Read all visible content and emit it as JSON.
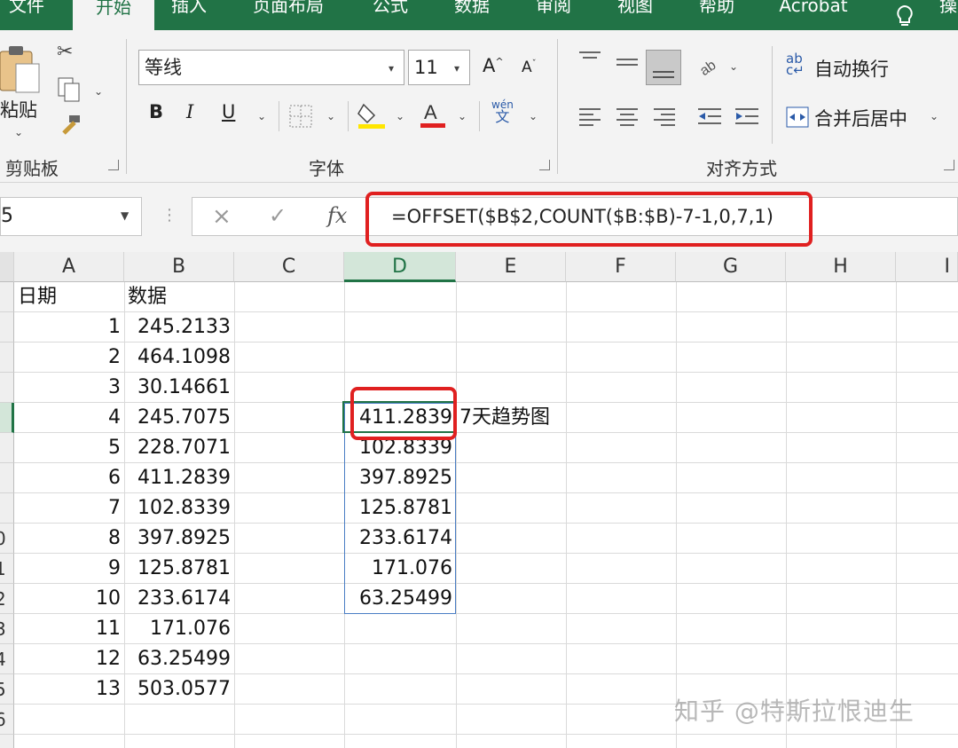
{
  "ribbon_tabs": [
    "文件",
    "开始",
    "插入",
    "页面布局",
    "公式",
    "数据",
    "审阅",
    "视图",
    "帮助",
    "Acrobat",
    "操"
  ],
  "active_tab": "开始",
  "clipboard": {
    "paste_label": "粘贴",
    "group_label": "剪贴板"
  },
  "font": {
    "family": "等线",
    "size": "11",
    "bold": "B",
    "italic": "I",
    "underline": "U",
    "phonetic": "wén\n文",
    "group_label": "字体"
  },
  "alignment": {
    "wrap_text": "自动换行",
    "merge_center": "合并后居中",
    "group_label": "对齐方式"
  },
  "formula_bar": {
    "name_box": "5",
    "fx": "fx",
    "cancel": "×",
    "enter": "✓",
    "formula": "=OFFSET($B$2,COUNT($B:$B)-7-1,0,7,1)"
  },
  "columns": [
    "A",
    "B",
    "C",
    "D",
    "E",
    "F",
    "G",
    "H",
    "I"
  ],
  "row_numbers": [
    "",
    "",
    "",
    "",
    "",
    "",
    "",
    "",
    "0",
    "1",
    "2",
    "3",
    "4",
    "5",
    "6"
  ],
  "headers": {
    "a1": "日期",
    "b1": "数据"
  },
  "table_rows": [
    {
      "a": "1",
      "b": "245.2133"
    },
    {
      "a": "2",
      "b": "464.1098"
    },
    {
      "a": "3",
      "b": "30.14661"
    },
    {
      "a": "4",
      "b": "245.7075"
    },
    {
      "a": "5",
      "b": "228.7071"
    },
    {
      "a": "6",
      "b": "411.2839"
    },
    {
      "a": "7",
      "b": "102.8339"
    },
    {
      "a": "8",
      "b": "397.8925"
    },
    {
      "a": "9",
      "b": "125.8781"
    },
    {
      "a": "10",
      "b": "233.6174"
    },
    {
      "a": "11",
      "b": "171.076"
    },
    {
      "a": "12",
      "b": "63.25499"
    },
    {
      "a": "13",
      "b": "503.0577"
    }
  ],
  "d_values": [
    "411.2839",
    "102.8339",
    "397.8925",
    "125.8781",
    "233.6174",
    "171.076",
    "63.25499"
  ],
  "e_label": "7天趋势图",
  "watermark": "知乎 @特斯拉恨迪生",
  "colors": {
    "excel_green": "#217346",
    "highlight_red": "#e02020",
    "font_yellow": "#ffe600",
    "font_red": "#e02020"
  }
}
